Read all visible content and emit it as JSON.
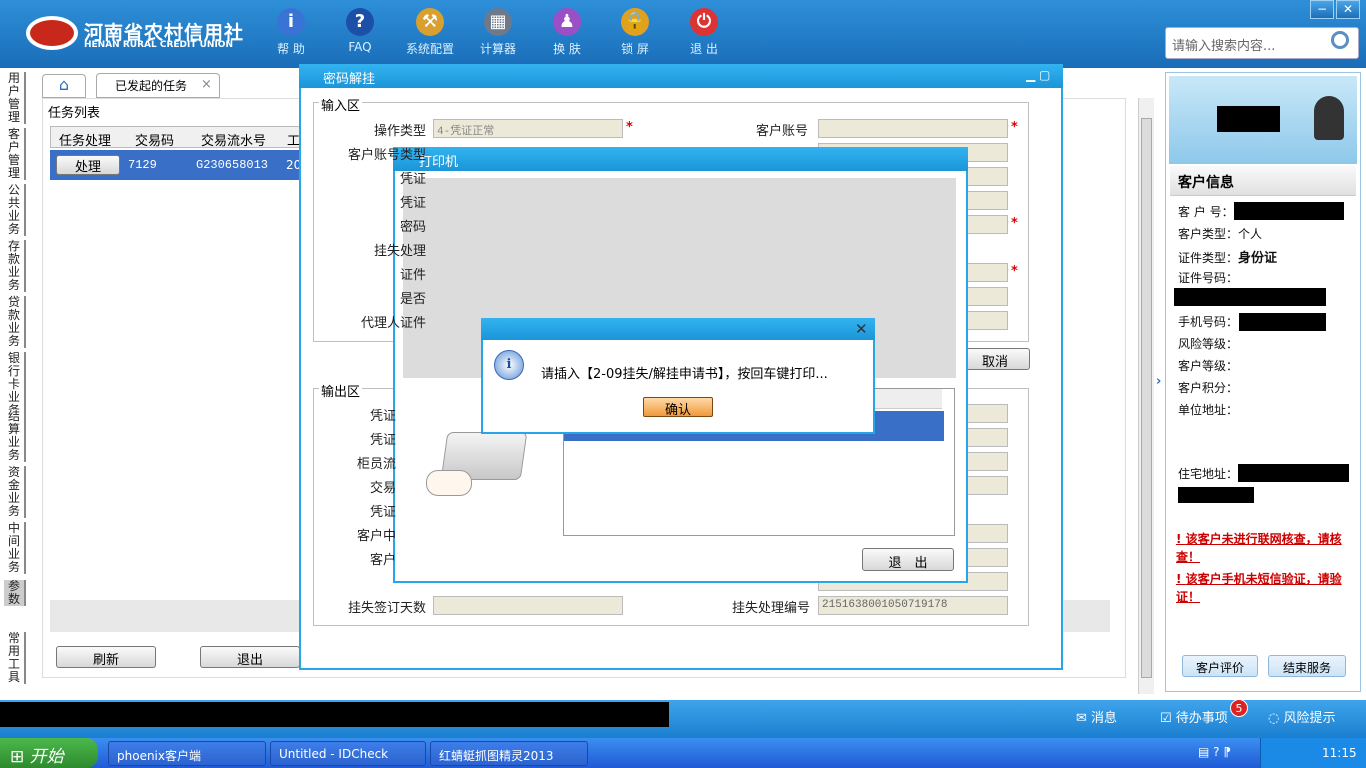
{
  "app": {
    "brand_cn": "河南省农村信用社",
    "brand_en": "HENAN RURAL CREDIT UNION"
  },
  "toolbar": [
    {
      "label": "帮 助",
      "icon": "info-icon",
      "glyph": "i",
      "color": "#3a73d6"
    },
    {
      "label": "FAQ",
      "icon": "question-icon",
      "glyph": "?",
      "color": "#1c4fa8"
    },
    {
      "label": "系统配置",
      "icon": "toolbox-icon",
      "glyph": "⚒",
      "color": "#d9a030"
    },
    {
      "label": "计算器",
      "icon": "calculator-icon",
      "glyph": "▦",
      "color": "#6c7a8c"
    },
    {
      "label": "换 肤",
      "icon": "shirt-icon",
      "glyph": "♟",
      "color": "#9a4fc7"
    },
    {
      "label": "锁 屏",
      "icon": "lock-icon",
      "glyph": "🔒",
      "color": "#e0a020"
    },
    {
      "label": "退 出",
      "icon": "power-icon",
      "glyph": "⏻",
      "color": "#d33"
    }
  ],
  "window_controls": {
    "minimize": "−",
    "close": "✕"
  },
  "search": {
    "placeholder": "请输入搜索内容..."
  },
  "left_tabs": [
    "用户管理",
    "客户管理",
    "公共业务",
    "存款业务",
    "贷款业务",
    "银行卡业务",
    "结算业务",
    "资金业务",
    "中间业务",
    "参数",
    "常用工具"
  ],
  "tabs": {
    "home_glyph": "⌂",
    "active": "已发起的任务",
    "close": "×"
  },
  "task_list": {
    "title": "任务列表",
    "columns": [
      "任务处理",
      "交易码",
      "交易流水号",
      "工"
    ],
    "rows": [
      {
        "action": "处理",
        "code": "7129",
        "serial": "G230658013",
        "extra": "20"
      }
    ],
    "refresh": "刷新",
    "exit": "退出"
  },
  "pwd_dialog": {
    "title": "密码解挂",
    "input_section": "输入区",
    "output_section": "输出区",
    "fields_left": [
      "操作类型",
      "客户账号类型",
      "凭证",
      "凭证",
      "密码",
      "挂失处理",
      "证件",
      "是否",
      "代理人证件"
    ],
    "op_type_value": "4-凭证正常",
    "fields_right": [
      "客户账号"
    ],
    "output_left": [
      "凭证",
      "凭证",
      "柜员流",
      "交易",
      "凭证",
      "客户中",
      "客户"
    ],
    "bottom_left": "挂失签订天数",
    "bottom_right": "挂失处理编号",
    "bottom_right_value": "2151638001050719178",
    "cancel": "取消"
  },
  "printer_dialog": {
    "title": "打印机",
    "exit": "退　出"
  },
  "alert": {
    "message": "请插入【2-09挂失/解挂申请书】，按回车键打印...",
    "confirm": "确认",
    "close": "✕"
  },
  "customer": {
    "header": "客户信息",
    "fields": [
      {
        "label": "客 户 号：",
        "value": ""
      },
      {
        "label": "客户类型：",
        "value": "个人"
      },
      {
        "label": "证件类型：",
        "value": "身份证"
      },
      {
        "label": "证件号码：",
        "value": ""
      },
      {
        "label": "手机号码：",
        "value": ""
      },
      {
        "label": "风险等级：",
        "value": ""
      },
      {
        "label": "客户等级：",
        "value": ""
      },
      {
        "label": "客户积分：",
        "value": ""
      },
      {
        "label": "单位地址：",
        "value": ""
      },
      {
        "label": "住宅地址：",
        "value": ""
      }
    ],
    "warning1": "该客户未进行联网核查，请核查！",
    "warning2": "该客户手机未短信验证，请验证！",
    "rate_btn": "客户评价",
    "end_btn": "结束服务"
  },
  "statusbar": {
    "messages": "消息",
    "todo": "待办事项",
    "todo_count": "5",
    "risk": "风险提示"
  },
  "taskbar": {
    "start": "开始",
    "items": [
      "phoenix客户端",
      "Untitled - IDCheck",
      "红蜻蜓抓图精灵2013"
    ],
    "clock": "11:15"
  }
}
